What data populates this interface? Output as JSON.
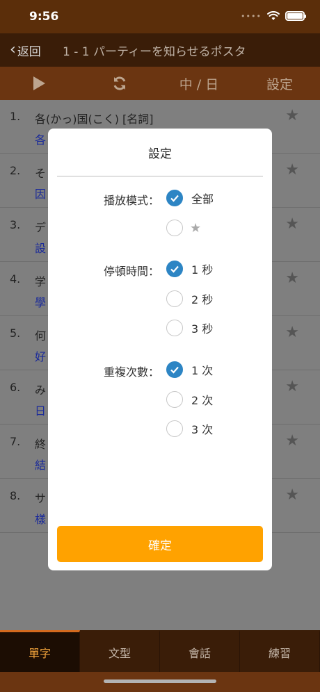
{
  "status": {
    "time": "9:56"
  },
  "nav": {
    "back_label": "返回",
    "title": "1 - 1 パーティーを知らせるポスタ"
  },
  "toolbar": {
    "play_icon": "play-icon",
    "repeat_icon": "refresh-icon",
    "language": "中 / 日",
    "settings": "設定"
  },
  "list": [
    {
      "num": "1.",
      "term": "各(かっ)国(こく)  [名詞]",
      "translation": "各"
    },
    {
      "num": "2.",
      "term": "そ",
      "translation": "因"
    },
    {
      "num": "3.",
      "term": "デ",
      "translation": "設"
    },
    {
      "num": "4.",
      "term": "学",
      "translation": "學"
    },
    {
      "num": "5.",
      "term": "何",
      "translation": "好"
    },
    {
      "num": "6.",
      "term": "み",
      "translation": "日"
    },
    {
      "num": "7.",
      "term": "終",
      "translation": "結"
    },
    {
      "num": "8.",
      "term": "サ",
      "translation": "樣"
    }
  ],
  "modal": {
    "title": "設定",
    "play_mode": {
      "label": "播放模式：",
      "options": [
        "全部",
        ""
      ],
      "selected": 0
    },
    "pause_time": {
      "label": "停頓時間：",
      "options": [
        "1 秒",
        "2 秒",
        "3 秒"
      ],
      "selected": 0
    },
    "repeat_count": {
      "label": "重複次數：",
      "options": [
        "1 次",
        "2 次",
        "3 次"
      ],
      "selected": 0
    },
    "confirm_label": "確定"
  },
  "tabs": [
    {
      "label": "單字",
      "active": true
    },
    {
      "label": "文型",
      "active": false
    },
    {
      "label": "會話",
      "active": false
    },
    {
      "label": "練習",
      "active": false
    }
  ],
  "colors": {
    "accent": "#ffa200",
    "check": "#2d85c4",
    "header": "#3a1d08"
  }
}
